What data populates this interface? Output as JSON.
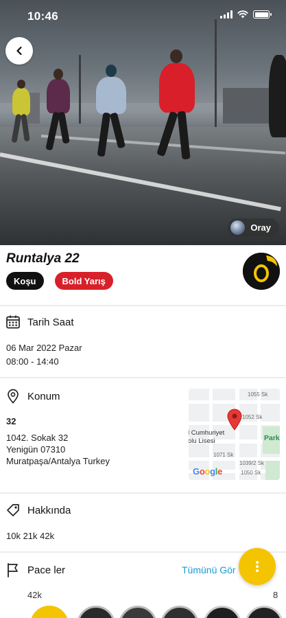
{
  "status_bar": {
    "time": "10:46"
  },
  "hero": {
    "photo_credit": "Oray"
  },
  "event": {
    "title": "Runtalya 22",
    "tags": [
      "Koşu",
      "Bold Yarış"
    ]
  },
  "date_section": {
    "title": "Tarih Saat",
    "date": "06 Mar 2022 Pazar",
    "time": "08:00 - 14:40"
  },
  "location_section": {
    "title": "Konum",
    "name": "32",
    "address_line1": "1042. Sokak 32",
    "address_line2": "Yenigün  07310",
    "address_line3": "Muratpaşa/Antalya Turkey",
    "map": {
      "labels": [
        "1055 Sk",
        "1052 Sk",
        "l Cumhuriyet",
        "olu Lisesi",
        "Park",
        "1071 Sk",
        "1039/2 Sk",
        "1050 Sk"
      ],
      "google": "Google"
    }
  },
  "about_section": {
    "title": "Hakkında",
    "text": "10k 21k 42k"
  },
  "pacers_section": {
    "title": "Pace ler",
    "see_all": "Tümünü Gör",
    "pace_labels": [
      "42k",
      "8"
    ]
  },
  "colors": {
    "accent_yellow": "#f4c400",
    "tag_red": "#d8202a",
    "link_blue": "#1a9ad6"
  }
}
